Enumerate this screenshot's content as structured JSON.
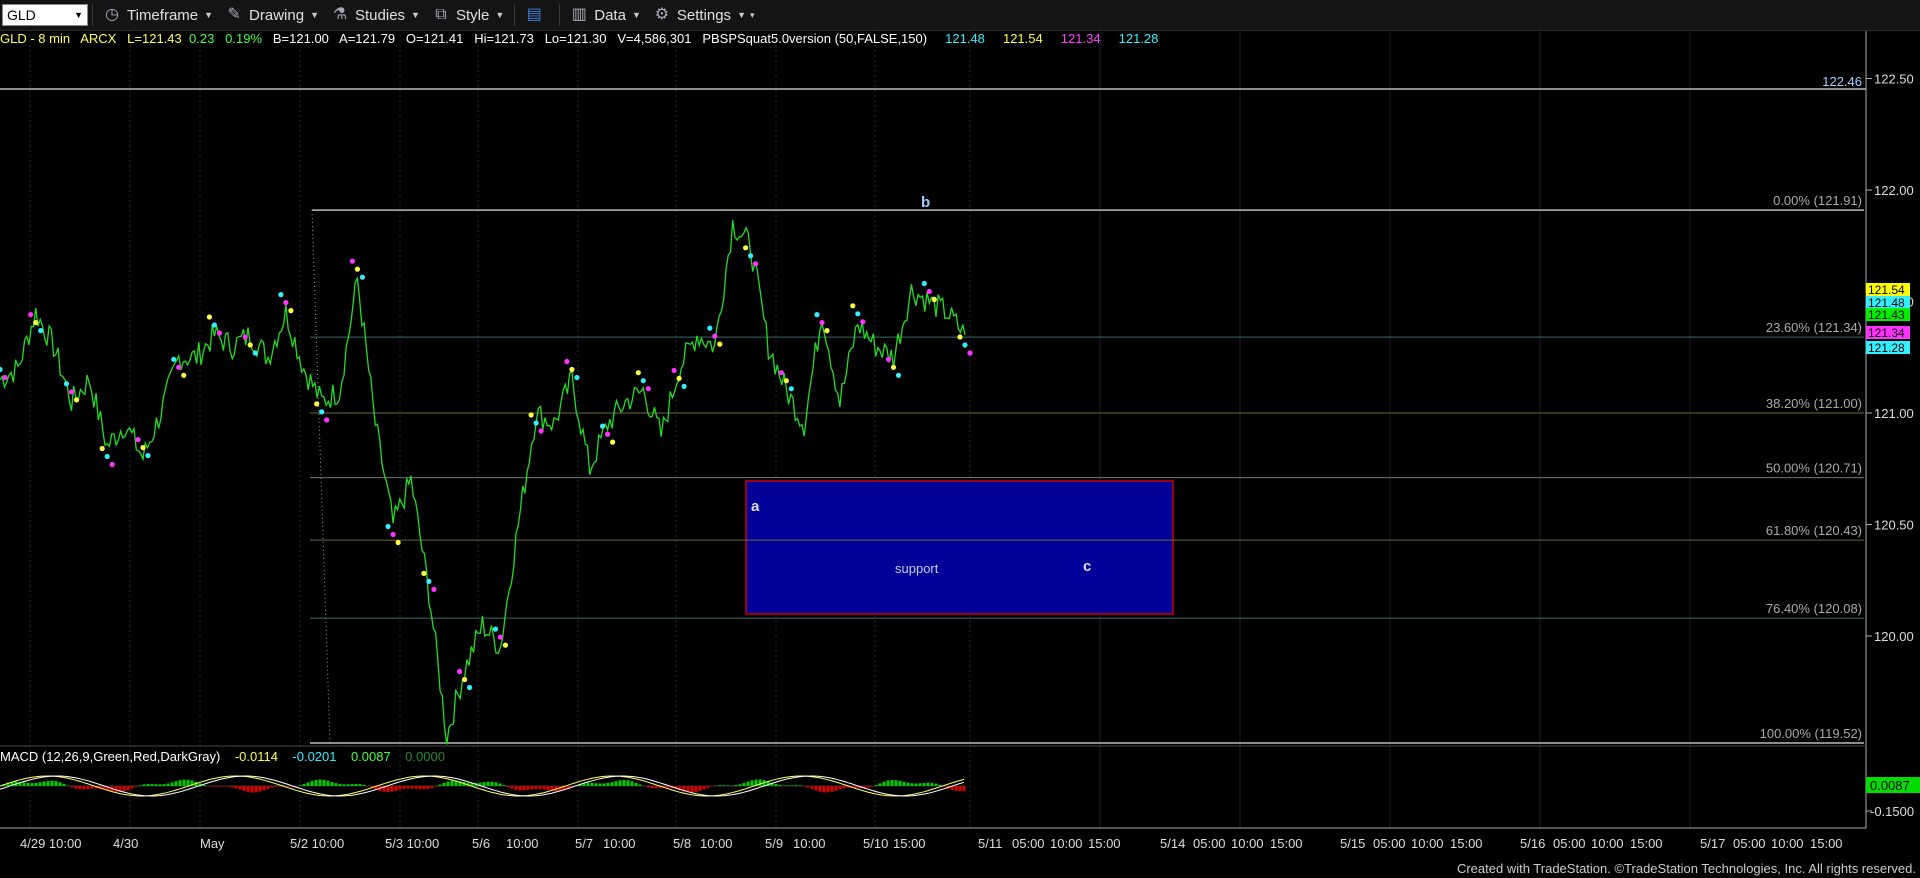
{
  "toolbar": {
    "symbol": "GLD",
    "timeframe_label": "Timeframe",
    "drawing_label": "Drawing",
    "studies_label": "Studies",
    "style_label": "Style",
    "data_label": "Data",
    "settings_label": "Settings"
  },
  "info": {
    "symbol_interval": "GLD - 8 min",
    "exchange": "ARCX",
    "last": "L=121.43",
    "change": "0.23",
    "change_pct": "0.19%",
    "bid": "B=121.00",
    "ask": "A=121.79",
    "open": "O=121.41",
    "high": "Hi=121.73",
    "low": "Lo=121.30",
    "volume": "V=4,586,301",
    "study": "PBSPSquat5.0version (50,FALSE,150)",
    "study_vals": [
      "121.48",
      "121.54",
      "121.34",
      "121.28"
    ]
  },
  "macd": {
    "label": "MACD (12,26,9,Green,Red,DarkGray)",
    "vals": [
      "-0.0114",
      "-0.0201",
      "0.0087",
      "0.0000"
    ],
    "axis_top": "0.0087",
    "axis_bottom": "-0.1500"
  },
  "price_axis": [
    "122.50",
    "122.00",
    "121.50",
    "121.00",
    "120.50",
    "120.00"
  ],
  "price_tags": [
    "121.54",
    "121.48",
    "121.43",
    "121.34",
    "121.28"
  ],
  "hline_label": "122.46",
  "fib_labels": [
    "0.00% (121.91)",
    "23.60% (121.34)",
    "38.20% (121.00)",
    "50.00% (120.71)",
    "61.80% (120.43)",
    "76.40% (120.08)",
    "100.00% (119.52)"
  ],
  "wave_labels": [
    "a",
    "b",
    "c"
  ],
  "support_label": "support",
  "time_axis": [
    "4/29 10:00",
    "4/30",
    "May",
    "5/2 10:00",
    "5/3 10:00",
    "5/6",
    "10:00",
    "5/7",
    "10:00",
    "5/8",
    "10:00",
    "5/9",
    "10:00",
    "5/10",
    "15:00",
    "5/11",
    "05:00",
    "10:00",
    "15:00",
    "5/14",
    "05:00",
    "10:00",
    "15:00",
    "5/15",
    "05:00",
    "10:00",
    "15:00",
    "5/16",
    "05:00",
    "10:00",
    "15:00",
    "5/17",
    "05:00",
    "10:00",
    "15:00"
  ],
  "footer": "Created with TradeStation. ©TradeStation Technologies, Inc. All rights reserved.",
  "colors": {
    "price_line": "#22dd22",
    "macd_green": "#00cc00",
    "macd_red": "#dd0000",
    "support_box": "#000099",
    "support_border": "#cc0000",
    "dot_yellow": "#ffff44",
    "dot_cyan": "#33eeff",
    "dot_magenta": "#ff33ff"
  },
  "chart_data": {
    "type": "line",
    "y_range": [
      119.4,
      122.6
    ],
    "x": [
      "4/29",
      "4/30",
      "5/1",
      "5/2",
      "5/3",
      "5/6",
      "5/7",
      "5/8",
      "5/9",
      "5/10"
    ],
    "series": [
      {
        "values": [
          121.15,
          121.2,
          121.45,
          121.3,
          121.05,
          121.15,
          120.85,
          120.95,
          120.8,
          121.0,
          121.25,
          121.25,
          121.35,
          121.3,
          121.35,
          121.25,
          121.45,
          121.2,
          121.05,
          121.1,
          121.6,
          120.95,
          120.5,
          120.7,
          120.2,
          119.55,
          119.85,
          120.05,
          119.95,
          120.5,
          121.0,
          120.95,
          121.15,
          120.75,
          120.95,
          121.05,
          121.1,
          120.9,
          121.2,
          121.35,
          121.3,
          121.85,
          121.75,
          121.3,
          121.1,
          120.95,
          121.45,
          121.05,
          121.4,
          121.3,
          121.25,
          121.55,
          121.5,
          121.45,
          121.35
        ]
      }
    ],
    "fib_levels": [
      121.91,
      121.34,
      121.0,
      120.71,
      120.43,
      120.08,
      119.52
    ],
    "hline": 122.46,
    "support_zone": [
      120.1,
      120.7
    ]
  }
}
